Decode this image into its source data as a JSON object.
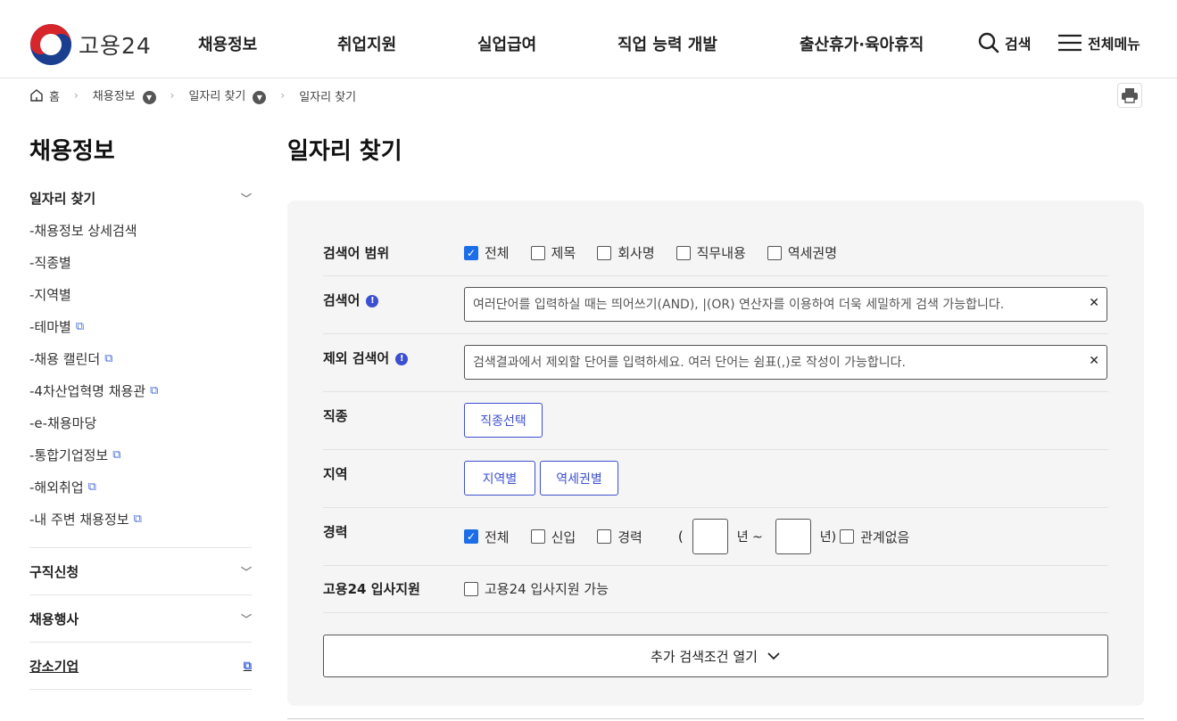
{
  "header": {
    "logo_text": "고용24",
    "nav": [
      "채용정보",
      "취업지원",
      "실업급여",
      "직업 능력 개발",
      "출산휴가·육아휴직"
    ],
    "search_label": "검색",
    "menu_label": "전체메뉴"
  },
  "breadcrumb": {
    "home": "홈",
    "level1": "채용정보",
    "level2": "일자리 찾기",
    "current": "일자리 찾기"
  },
  "sidebar": {
    "title": "채용정보",
    "group1": "일자리 찾기",
    "items": [
      {
        "label": "-채용정보 상세검색"
      },
      {
        "label": "-직종별"
      },
      {
        "label": "-지역별"
      },
      {
        "label": "-테마별"
      },
      {
        "label": "-채용 캘린더"
      },
      {
        "label": "-4차산업혁명 채용관"
      },
      {
        "label": "-e-채용마당"
      },
      {
        "label": "-통합기업정보"
      },
      {
        "label": "-해외취업"
      },
      {
        "label": "-내 주변 채용정보"
      }
    ],
    "group2": "구직신청",
    "group3": "채용행사",
    "group4": "강소기업"
  },
  "main": {
    "title": "일자리 찾기",
    "scope": {
      "label": "검색어 범위",
      "options": [
        "전체",
        "제목",
        "회사명",
        "직무내용",
        "역세권명"
      ],
      "checked": "전체"
    },
    "keyword": {
      "label": "검색어",
      "placeholder": "여러단어를 입력하실 때는 띄어쓰기(AND), |(OR) 연산자를 이용하여 더욱 세밀하게 검색 가능합니다."
    },
    "exclude": {
      "label": "제외 검색어",
      "placeholder": "검색결과에서 제외할 단어를 입력하세요. 여러 단어는 쉼표(,)로 작성이 가능합니다."
    },
    "job": {
      "label": "직종",
      "button": "직종선택"
    },
    "region": {
      "label": "지역",
      "button1": "지역별",
      "button2": "역세권별"
    },
    "career": {
      "label": "경력",
      "options": [
        "전체",
        "신입",
        "경력"
      ],
      "checked": "전체",
      "open_paren": "(",
      "year_from": "년 ~",
      "year_to": "년)",
      "any": "관계없음"
    },
    "support": {
      "label": "고용24 입사지원",
      "option": "고용24 입사지원 가능"
    },
    "more_button": "추가 검색조건 열기"
  },
  "colors": {
    "accent": "#3d4fd1",
    "checkbox": "#1c6ee8",
    "panel_bg": "#f5f5f5"
  }
}
